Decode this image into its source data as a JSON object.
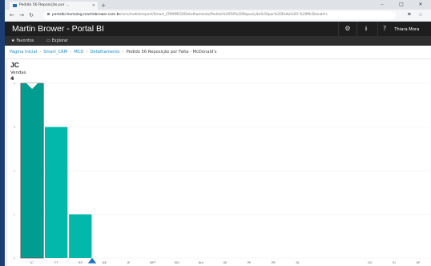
{
  "browser": {
    "tab_title": "Pedido 56 Reposição por ...",
    "tab_close": "×",
    "url_host": "portalbi-homolog.martinbrower.com.br",
    "url_path": "/ssrs/mobilereport/Smart_CRM/MCD/Detalhamento/Pedido%2056%20Reposição%20por%20Falta%20-%20McDonald's",
    "icons": {
      "back": "arrow-left-icon",
      "forward": "arrow-right-icon",
      "reload": "reload-icon",
      "star": "star-icon"
    }
  },
  "header": {
    "title": "Martin Brower - Portal BI",
    "user": "Thiara Mora",
    "icons": [
      "gear-icon",
      "download-icon",
      "help-icon"
    ]
  },
  "subnav": {
    "favorites": "Favoritos",
    "explore": "Explorar"
  },
  "breadcrumb": {
    "items": [
      "Página Inicial",
      "Smart_CRM",
      "MCD",
      "Detalhamento"
    ],
    "current": "Pedido 56 Reposição por Falta - McDonald's"
  },
  "card": {
    "title": "JC",
    "subtitle": "Vendas",
    "value": "4"
  },
  "chart_data": {
    "type": "bar",
    "categories": [
      "JC",
      "FT",
      "RP",
      "NE",
      "JP",
      "MPT",
      "MG",
      "Nm",
      "SE",
      "PE",
      "PR",
      "RJ",
      "",
      "",
      "GO",
      "SI",
      "SP"
    ],
    "values": [
      4,
      3,
      1,
      0,
      0,
      0,
      0,
      0,
      0,
      0,
      0,
      0,
      0,
      0,
      0,
      0,
      0
    ],
    "ylim": [
      0,
      4
    ],
    "grid": true,
    "selected_index": 0,
    "colors": {
      "bar": "#01b8aa",
      "selected": "#019d91",
      "grid": "#eeeeee"
    }
  }
}
